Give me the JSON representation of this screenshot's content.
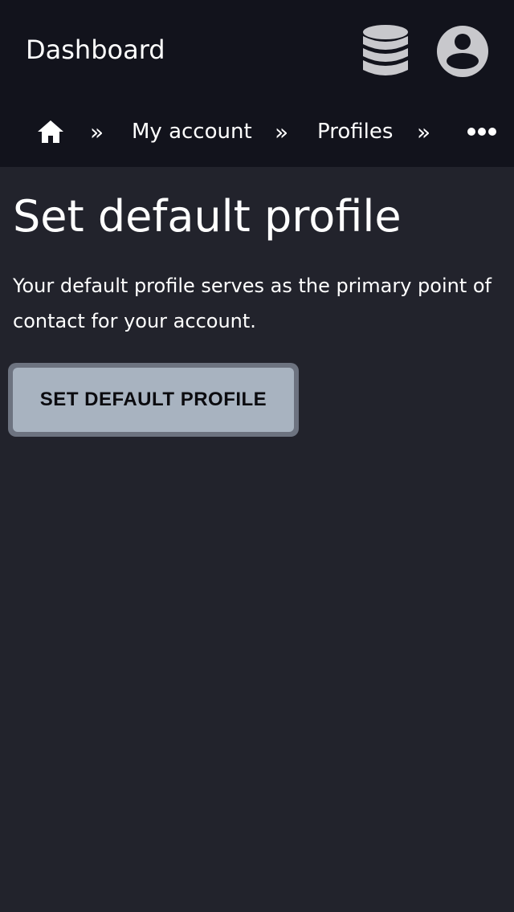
{
  "header": {
    "title": "Dashboard",
    "icons": {
      "database": "database-icon",
      "account": "account-circle-icon"
    },
    "icon_color": "#c8c8cc"
  },
  "breadcrumb": {
    "items": [
      {
        "label": "",
        "icon": "home-icon"
      },
      {
        "label": "My account"
      },
      {
        "label": "Profiles"
      }
    ],
    "separator": "»",
    "overflow_icon": "more-horizontal-icon"
  },
  "main": {
    "title": "Set default profile",
    "description": "Your default profile serves as the primary point of contact for your account.",
    "button_label": "SET DEFAULT PROFILE"
  },
  "colors": {
    "header_bg": "#12131c",
    "page_bg": "#22232c",
    "button_bg": "#a8b3c0",
    "button_ring": "#6d7380"
  }
}
